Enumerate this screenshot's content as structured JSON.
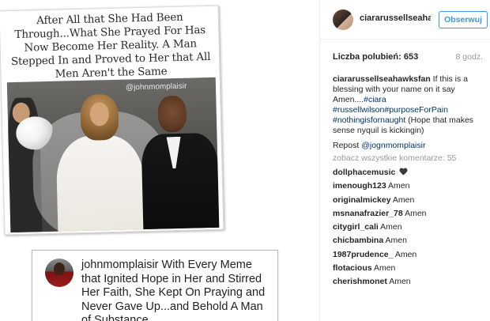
{
  "image": {
    "meme_caption": "After All that She Had Been Through...What She Prayed For Has Now Become Her Reality. A Man Stepped In and Proved to Her that All Men Aren't the Same",
    "meme_watermark": "@johnmomplaisir",
    "quote": {
      "username": "johnmomplaisir",
      "text": "With Every Meme that Ignited Hope in Her and Stirred Her Faith, She Kept On Praying and Never Gave Up...and Behold A Man of Substance."
    }
  },
  "post": {
    "owner": "ciararussellseaha...",
    "follow_label": "Obserwuj",
    "likes_label": "Liczba polubień: 653",
    "time_ago": "8 godz.",
    "caption": {
      "author": "ciararussellseahawksfan",
      "text_before": "If this is a blessing with your name on it say Amen....",
      "tag1": "#ciara",
      "tag2": "#russellwilson",
      "tag3": "#purposeForPain",
      "tag4": "#nothingisfornaught",
      "text_after": "(Hope that makes sense nyquil is kickingin)"
    },
    "repost_prefix": "Repost",
    "repost_user": "@jognmomplaisir",
    "view_all": "zobacz wszystkie komentarze: 55",
    "comments": [
      {
        "author": "dollphacemusic",
        "text": "",
        "icon": "heart-icon"
      },
      {
        "author": "imenough123",
        "text": "Amen"
      },
      {
        "author": "originalmickey",
        "text": "Amen"
      },
      {
        "author": "msnanafrazier_78",
        "text": "Amen"
      },
      {
        "author": "citygirl_cali",
        "text": "Amen"
      },
      {
        "author": "chicbambina",
        "text": "Amen"
      },
      {
        "author": "1987prudence_",
        "text": "Amen"
      },
      {
        "author": "flotacious",
        "text": "Amen"
      },
      {
        "author": "cherishmonet",
        "text": "Amen"
      }
    ]
  },
  "colors": {
    "link": "#003569",
    "follow_blue": "#3897f0",
    "muted": "#999999"
  }
}
